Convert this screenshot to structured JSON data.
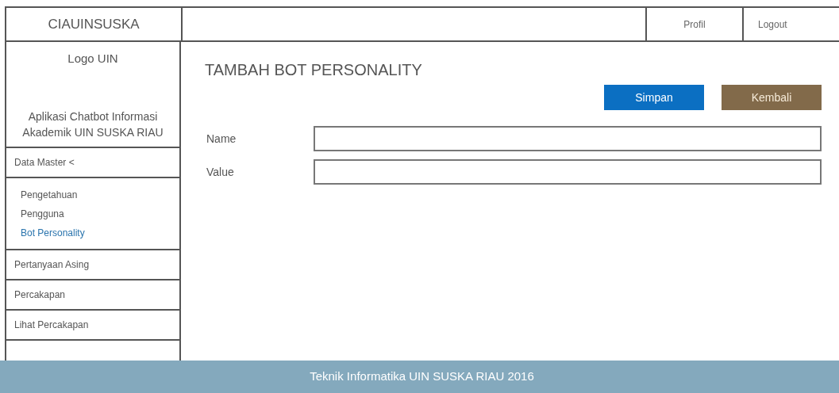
{
  "brand": "CIAUINSUSKA",
  "header_links": [
    "Profil",
    "Logout"
  ],
  "sidebar": {
    "logo": "Logo UIN",
    "description": "Aplikasi Chatbot Informasi Akademik UIN SUSKA RIAU",
    "items": [
      {
        "label": "Data Master <",
        "children": [
          {
            "label": "Pengetahuan",
            "selected": false
          },
          {
            "label": "Pengguna",
            "selected": false
          },
          {
            "label": "Bot Personality",
            "selected": true
          }
        ]
      },
      {
        "label": "Pertanyaan Asing"
      },
      {
        "label": "Percakapan"
      },
      {
        "label": "Lihat Percakapan"
      }
    ]
  },
  "page_title": "TAMBAH BOT PERSONALITY",
  "buttons": [
    {
      "label": "Simpan",
      "kind": "primary"
    },
    {
      "label": "Kembali",
      "kind": "secondary"
    }
  ],
  "form_fields": [
    {
      "label": "Name"
    },
    {
      "label": "Value"
    }
  ],
  "footer": "Teknik Informatika UIN SUSKA RIAU 2016"
}
